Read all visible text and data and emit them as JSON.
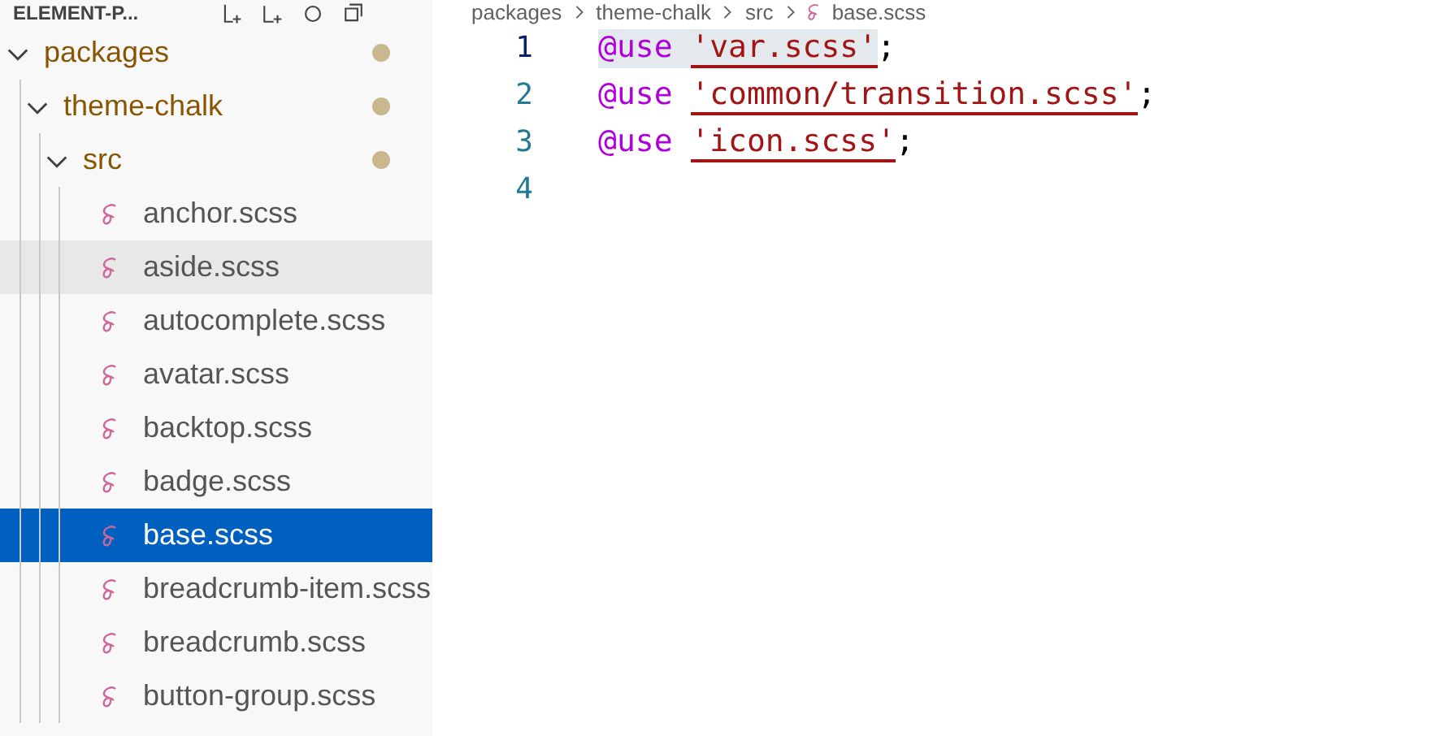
{
  "explorer": {
    "title": "ELEMENT-P..."
  },
  "tree": [
    {
      "label": "packages",
      "kind": "folder",
      "expanded": true,
      "modified": true,
      "selected": false,
      "hovered": false,
      "children": [
        {
          "label": "theme-chalk",
          "kind": "folder",
          "expanded": true,
          "modified": true,
          "selected": false,
          "hovered": false,
          "children": [
            {
              "label": "src",
              "kind": "folder",
              "expanded": true,
              "modified": true,
              "selected": false,
              "hovered": false,
              "children": [
                {
                  "label": "anchor.scss",
                  "kind": "scss",
                  "selected": false,
                  "hovered": false
                },
                {
                  "label": "aside.scss",
                  "kind": "scss",
                  "selected": false,
                  "hovered": true
                },
                {
                  "label": "autocomplete.scss",
                  "kind": "scss",
                  "selected": false,
                  "hovered": false
                },
                {
                  "label": "avatar.scss",
                  "kind": "scss",
                  "selected": false,
                  "hovered": false
                },
                {
                  "label": "backtop.scss",
                  "kind": "scss",
                  "selected": false,
                  "hovered": false
                },
                {
                  "label": "badge.scss",
                  "kind": "scss",
                  "selected": false,
                  "hovered": false
                },
                {
                  "label": "base.scss",
                  "kind": "scss",
                  "selected": true,
                  "hovered": false
                },
                {
                  "label": "breadcrumb-item.scss",
                  "kind": "scss",
                  "selected": false,
                  "hovered": false
                },
                {
                  "label": "breadcrumb.scss",
                  "kind": "scss",
                  "selected": false,
                  "hovered": false
                },
                {
                  "label": "button-group.scss",
                  "kind": "scss",
                  "selected": false,
                  "hovered": false
                }
              ]
            }
          ]
        }
      ]
    }
  ],
  "breadcrumb": [
    {
      "label": "packages",
      "kind": "folder"
    },
    {
      "label": "theme-chalk",
      "kind": "folder"
    },
    {
      "label": "src",
      "kind": "folder"
    },
    {
      "label": "base.scss",
      "kind": "scss"
    }
  ],
  "editor": {
    "lines": [
      {
        "number": "1",
        "current": true,
        "tokens": [
          {
            "kind": "keyword",
            "text": "@use",
            "highlighted": true
          },
          {
            "kind": "string",
            "text": "'var.scss'",
            "highlighted": true,
            "error": true
          },
          {
            "kind": "punct",
            "text": ";",
            "highlighted": false
          }
        ]
      },
      {
        "number": "2",
        "current": false,
        "tokens": [
          {
            "kind": "keyword",
            "text": "@use",
            "highlighted": false
          },
          {
            "kind": "string",
            "text": "'common/transition.scss'",
            "highlighted": false,
            "error": true
          },
          {
            "kind": "punct",
            "text": ";",
            "highlighted": false
          }
        ]
      },
      {
        "number": "3",
        "current": false,
        "tokens": [
          {
            "kind": "keyword",
            "text": "@use",
            "highlighted": false
          },
          {
            "kind": "string",
            "text": "'icon.scss'",
            "highlighted": false,
            "error": true
          },
          {
            "kind": "punct",
            "text": ";",
            "highlighted": false
          }
        ]
      },
      {
        "number": "4",
        "current": false
      }
    ]
  }
}
